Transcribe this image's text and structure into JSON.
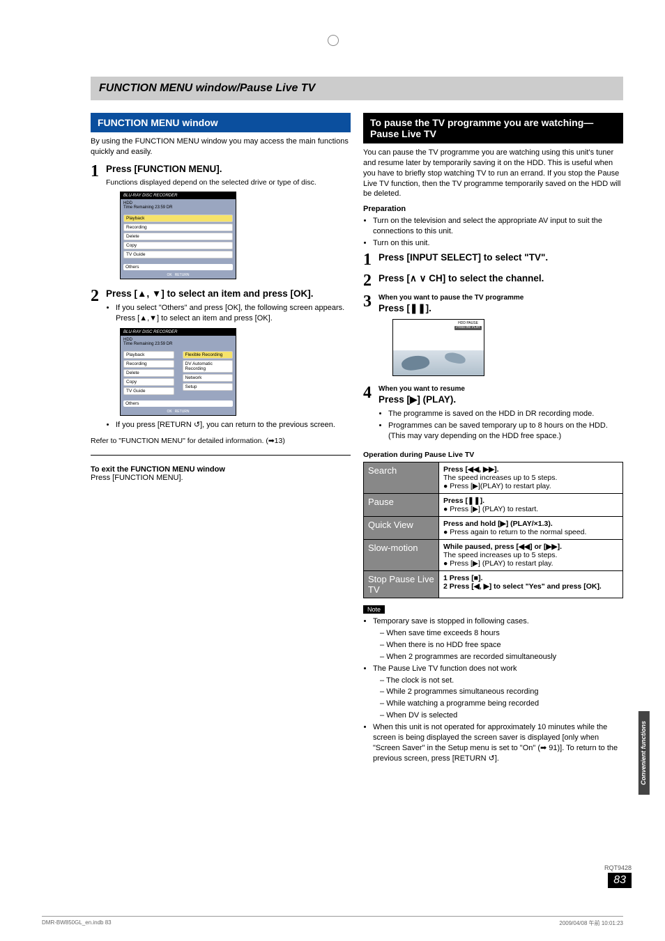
{
  "pageTitle": "FUNCTION MENU window/Pause Live TV",
  "left": {
    "header": "FUNCTION MENU window",
    "intro": "By using the FUNCTION MENU window you may access the main functions quickly and easily.",
    "step1": {
      "title": "Press [FUNCTION MENU].",
      "desc": "Functions displayed depend on the selected drive or type of disc."
    },
    "menu1": {
      "brand": "BLU-RAY DISC RECORDER",
      "hdd": "HDD",
      "rem": "Time Remaining    23:59 DR",
      "items": [
        "Playback",
        "Recording",
        "Delete",
        "Copy",
        "TV Guide"
      ],
      "others": "Others",
      "footer": [
        "OK",
        "RETURN"
      ]
    },
    "step2": {
      "title": "Press [▲, ▼] to select an item and press [OK].",
      "b1": "If you select \"Others\" and press [OK], the following screen appears. Press [▲,▼] to select an item and press [OK]."
    },
    "menu2": {
      "brand": "BLU-RAY DISC RECORDER",
      "hdd": "HDD",
      "rem": "Time Remaining    23:59 DR",
      "leftItems": [
        "Playback",
        "Recording",
        "Delete",
        "Copy",
        "TV Guide"
      ],
      "rightItems": [
        "Flexible Recording",
        "DV Automatic Recording",
        "Network",
        "Setup"
      ],
      "others": "Others",
      "footer": [
        "OK",
        "RETURN"
      ]
    },
    "returnBullet": "If you press [RETURN ↺], you can return to the previous screen.",
    "ref": "Refer to \"FUNCTION MENU\" for detailed information. (➡13)",
    "exitTitle": "To exit the FUNCTION MENU window",
    "exitBody": "Press [FUNCTION MENU]."
  },
  "right": {
    "header": "To pause the TV programme you are watching—Pause Live TV",
    "intro": "You can pause the TV programme you are watching using this unit's tuner and resume later by temporarily saving it on the HDD. This is useful when you have to briefly stop watching TV to run an errand. If you stop the Pause Live TV function, then the TV programme temporarily saved on the HDD will be deleted.",
    "prep": "Preparation",
    "prepItems": [
      "Turn on the television and select the appropriate AV input to suit the connections to this unit.",
      "Turn on this unit."
    ],
    "step1": {
      "title": "Press [INPUT SELECT] to select \"TV\"."
    },
    "step2": {
      "title": "Press [∧ ∨ CH] to select the channel."
    },
    "step3": {
      "pre": "When you want to pause the TV programme",
      "title": "Press [❚❚]."
    },
    "tvLabels": {
      "l1": "HDD",
      "l2": "PAUSE",
      "l3": "Press the PLAY"
    },
    "step4": {
      "pre": "When you want to resume",
      "title": "Press [▶] (PLAY).",
      "b1": "The programme is saved on the HDD in DR recording mode.",
      "b2": "Programmes can be saved temporary up to 8 hours on the HDD. (This may vary depending on the HDD free space.)"
    },
    "opCaption": "Operation during Pause Live TV",
    "table": {
      "rows": [
        {
          "name": "Search",
          "head": "Press [◀◀, ▶▶].",
          "lines": [
            "The speed increases up to 5 steps.",
            "● Press [▶](PLAY) to restart play."
          ]
        },
        {
          "name": "Pause",
          "head": "Press [❚❚].",
          "lines": [
            "● Press [▶] (PLAY) to restart."
          ]
        },
        {
          "name": "Quick View",
          "head": "Press and hold [▶] (PLAY/×1.3).",
          "lines": [
            "● Press again to return to the normal speed."
          ]
        },
        {
          "name": "Slow-motion",
          "head": "While paused, press [◀◀] or [▶▶].",
          "lines": [
            "The speed increases up to 5 steps.",
            "● Press [▶] (PLAY) to restart play."
          ]
        },
        {
          "name": "Stop Pause Live TV",
          "head": "",
          "numlines": [
            "1  Press [■].",
            "2  Press [◀, ▶] to select \"Yes\" and press [OK]."
          ]
        }
      ]
    },
    "noteLabel": "Note",
    "notes": {
      "n1": "Temporary save is stopped in following cases.",
      "n1subs": [
        "When save time exceeds 8 hours",
        "When there is no HDD free space",
        "When 2 programmes are recorded simultaneously"
      ],
      "n2": "The Pause Live TV function does not work",
      "n2subs": [
        "The clock is not set.",
        "While 2 programmes simultaneous recording",
        "While watching a programme being recorded",
        "When DV is selected"
      ],
      "n3": "When this unit is not operated for approximately 10 minutes while the screen is being displayed the screen saver is displayed [only when \"Screen Saver\" in the Setup menu is set to \"On\" (➡ 91)]. To return to the previous screen, press [RETURN ↺]."
    }
  },
  "sideTab": "Convenient functions",
  "rqCode": "RQT9428",
  "pageNum": "83",
  "footer": {
    "left": "DMR-BW850GL_en.indb   83",
    "right": "2009/04/08   午前 10:01:23"
  }
}
